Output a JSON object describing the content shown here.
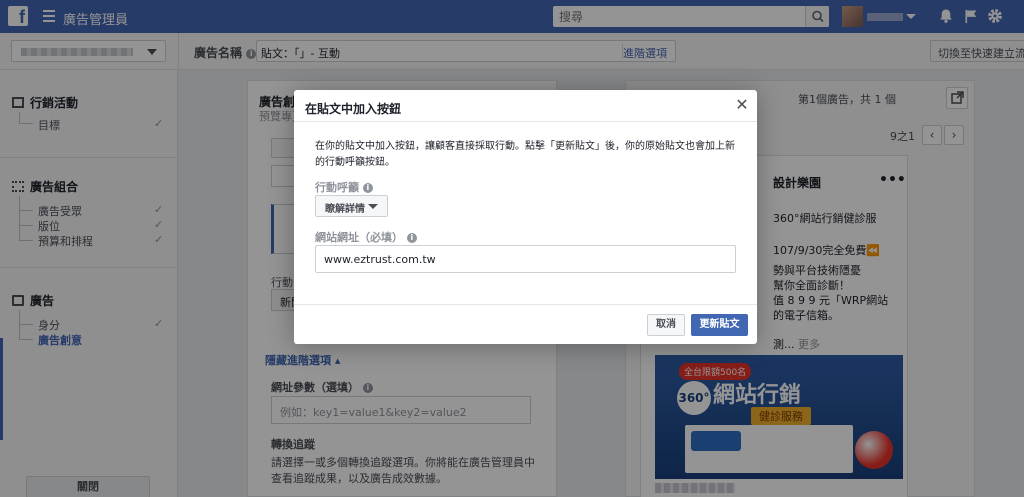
{
  "topbar": {
    "logo": "f",
    "app_title": "廣告管理員",
    "search_placeholder": "搜尋"
  },
  "subbar": {
    "ad_name_label": "廣告名稱",
    "ad_name_value": "貼文：「」- 互動",
    "naming_link": "進階選項",
    "quick_create_button": "切換至快速建立流程"
  },
  "leftnav": {
    "campaign": {
      "title": "行銷活動",
      "items": [
        "目標"
      ]
    },
    "adset": {
      "title": "廣告組合",
      "items": [
        "廣告受眾",
        "版位",
        "預算和排程"
      ]
    },
    "ad": {
      "title": "廣告",
      "items": [
        "身分",
        "廣告創意"
      ]
    },
    "close_button": "關閉"
  },
  "middle": {
    "title": "廣告創",
    "subtitle": "預覽專頁",
    "action_label": "行動中",
    "action_value": "新聞",
    "advanced_link": "隱藏進階選項 ▴",
    "url_params_label": "網址參數（選填）",
    "url_params_placeholder": "例如：key1=value1&key2=value2",
    "conversion_label": "轉換追蹤",
    "conversion_desc": "請選擇一或多個轉換追蹤選項。你將能在廣告管理員中查看追蹤成果，以及廣告成效數據。"
  },
  "right": {
    "ad_count": "第1個廣告，共 1 個",
    "page_indicator": "9之1",
    "prev": "‹",
    "next": "›",
    "preview": {
      "page_name": "設計樂園",
      "dots": "•••",
      "lines": [
        "360°網站行銷健診服",
        "107/9/30完全免費⏪",
        "勢與平台技術隱憂",
        "幫你全面診斷！",
        "值 8 9 9 元「WRP網站",
        "的電子信箱。"
      ],
      "more": "測... ",
      "more_link": "更多",
      "banner_badge": "全台限額500名",
      "banner_circle": "360°",
      "banner_big": "網站行銷",
      "banner_ribbon": "健診服務"
    }
  },
  "dialog": {
    "title": "在貼文中加入按鈕",
    "close": "✕",
    "description": "在你的貼文中加入按鈕，讓顧客直接採取行動。點擊「更新貼文」後，你的原始貼文也會加上新的行動呼籲按鈕。",
    "cta_label": "行動呼籲",
    "cta_value": "瞭解詳情",
    "url_label": "網站網址（必填）",
    "url_value": "www.eztrust.com.tw",
    "cancel_button": "取消",
    "update_button": "更新貼文"
  },
  "colors": {
    "brand_blue": "#4267b2",
    "overlay": "rgba(0,0,0,0.42)"
  }
}
